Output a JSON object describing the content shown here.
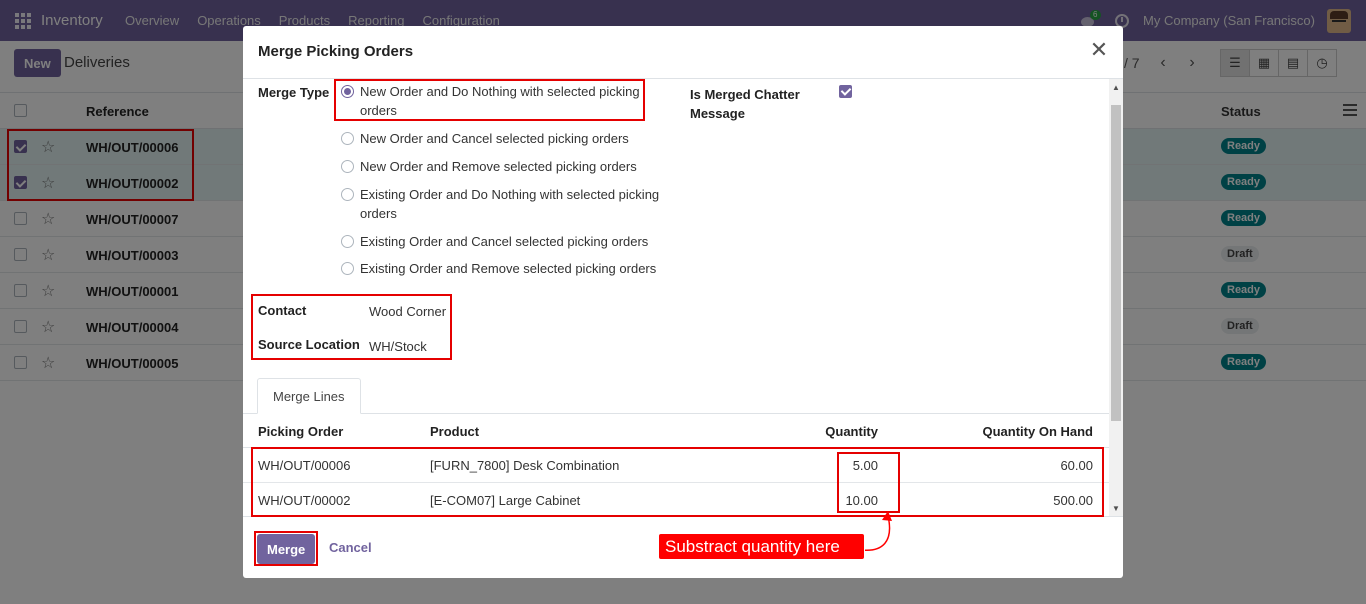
{
  "navbar": {
    "brand": "Inventory",
    "menu": [
      "Overview",
      "Operations",
      "Products",
      "Reporting",
      "Configuration"
    ],
    "chat_badge": "6",
    "company": "My Company (San Francisco)"
  },
  "control": {
    "new_label": "New",
    "title": "Deliveries",
    "pager": "/ 7"
  },
  "list": {
    "col_reference": "Reference",
    "col_status": "Status",
    "rows": [
      {
        "ref": "WH/OUT/00006",
        "status": "Ready",
        "selected": true
      },
      {
        "ref": "WH/OUT/00002",
        "status": "Ready",
        "selected": true
      },
      {
        "ref": "WH/OUT/00007",
        "status": "Ready",
        "selected": false
      },
      {
        "ref": "WH/OUT/00003",
        "status": "Draft",
        "selected": false
      },
      {
        "ref": "WH/OUT/00001",
        "status": "Ready",
        "selected": false
      },
      {
        "ref": "WH/OUT/00004",
        "status": "Draft",
        "selected": false
      },
      {
        "ref": "WH/OUT/00005",
        "status": "Ready",
        "selected": false
      }
    ]
  },
  "modal": {
    "title": "Merge Picking Orders",
    "merge_type_label": "Merge Type",
    "merge_options": [
      {
        "line1": "New Order and Do Nothing with selected picking",
        "line2": "orders",
        "checked": true
      },
      {
        "line1": "New Order and Cancel selected picking orders",
        "line2": "",
        "checked": false
      },
      {
        "line1": "New Order and Remove selected picking orders",
        "line2": "",
        "checked": false
      },
      {
        "line1": "Existing Order and Do Nothing with selected picking",
        "line2": "orders",
        "checked": false
      },
      {
        "line1": "Existing Order and Cancel selected picking orders",
        "line2": "",
        "checked": false
      },
      {
        "line1": "Existing Order and Remove selected picking orders",
        "line2": "",
        "checked": false
      }
    ],
    "chatter_label_1": "Is Merged Chatter",
    "chatter_label_2": "Message",
    "chatter_checked": true,
    "contact_label": "Contact",
    "contact_value": "Wood Corner",
    "source_label": "Source Location",
    "source_value": "WH/Stock",
    "tab_label": "Merge Lines",
    "lines_headers": {
      "picking": "Picking Order",
      "product": "Product",
      "quantity": "Quantity",
      "on_hand": "Quantity On Hand"
    },
    "lines": [
      {
        "picking": "WH/OUT/00006",
        "product": "[FURN_7800] Desk Combination",
        "quantity": "5.00",
        "on_hand": "60.00"
      },
      {
        "picking": "WH/OUT/00002",
        "product": "[E-COM07] Large Cabinet",
        "quantity": "10.00",
        "on_hand": "500.00"
      }
    ],
    "merge_button": "Merge",
    "cancel_button": "Cancel"
  },
  "annotation": {
    "callout_text": "Substract quantity here",
    "color": "#e50000"
  },
  "colors": {
    "brand": "#71639e",
    "ready": "#00838b"
  }
}
